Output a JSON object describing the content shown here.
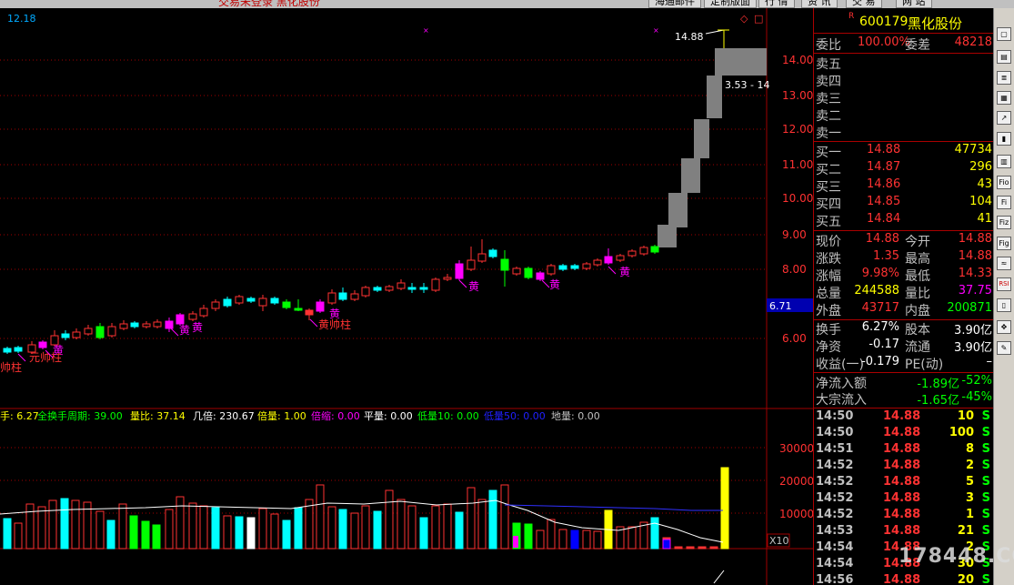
{
  "title_bar": {
    "text": "交易未登录  黑化股份"
  },
  "menu": [
    "海通邮件",
    "定制版面",
    "行 情",
    "资 讯",
    "交 易",
    "网 站"
  ],
  "price_axis": {
    "top_left_label": "12.18",
    "ticks": [
      "14.00",
      "13.00",
      "12.00",
      "11.00",
      "10.00",
      "9.00",
      "8.00",
      "6.00"
    ],
    "last_label": "6.71"
  },
  "chart_marks": {
    "high_label": "14.88",
    "range_label": "3.53 - 14",
    "huang": "黄",
    "yuanshuai": "元帅柱",
    "huangshuai": "黄帅柱",
    "hui": "帅柱"
  },
  "indicator_bar": {
    "items": [
      {
        "text": "手: 6.27",
        "color": "#ffff00"
      },
      {
        "text": "全换手周期: 39.00",
        "color": "#00ff00"
      },
      {
        "text": "量比: 37.14",
        "color": "#ffff00"
      },
      {
        "text": "几倍: 230.67",
        "color": "#ffffff"
      },
      {
        "text": "倍量: 1.00",
        "color": "#ffff00"
      },
      {
        "text": "倍缩: 0.00",
        "color": "#ff00ff"
      },
      {
        "text": "平量: 0.00",
        "color": "#ffffff"
      },
      {
        "text": "低量10: 0.00",
        "color": "#00ff00"
      },
      {
        "text": "低量50: 0.00",
        "color": "#0000ff"
      },
      {
        "text": "地量: 0.00",
        "color": "#c0c0c0"
      }
    ]
  },
  "volume_axis": {
    "ticks": [
      "30000",
      "20000",
      "10000"
    ],
    "unit": "X10"
  },
  "stock": {
    "code": "600179",
    "name": "黑化股份",
    "badge": "R"
  },
  "order_ratio": {
    "label1": "委比",
    "value1": "100.00%",
    "label2": "委差",
    "value2": "48218"
  },
  "sell": [
    {
      "label": "卖五",
      "price": "",
      "vol": ""
    },
    {
      "label": "卖四",
      "price": "",
      "vol": ""
    },
    {
      "label": "卖三",
      "price": "",
      "vol": ""
    },
    {
      "label": "卖二",
      "price": "",
      "vol": ""
    },
    {
      "label": "卖一",
      "price": "",
      "vol": ""
    }
  ],
  "buy": [
    {
      "label": "买一",
      "price": "14.88",
      "vol": "47734"
    },
    {
      "label": "买二",
      "price": "14.87",
      "vol": "296"
    },
    {
      "label": "买三",
      "price": "14.86",
      "vol": "43"
    },
    {
      "label": "买四",
      "price": "14.85",
      "vol": "104"
    },
    {
      "label": "买五",
      "price": "14.84",
      "vol": "41"
    }
  ],
  "quote": [
    {
      "l1": "现价",
      "v1": "14.88",
      "c1": "#ff3232",
      "l2": "今开",
      "v2": "14.88",
      "c2": "#ff3232"
    },
    {
      "l1": "涨跌",
      "v1": "1.35",
      "c1": "#ff3232",
      "l2": "最高",
      "v2": "14.88",
      "c2": "#ff3232"
    },
    {
      "l1": "涨幅",
      "v1": "9.98%",
      "c1": "#ff3232",
      "l2": "最低",
      "v2": "14.33",
      "c2": "#ff3232"
    },
    {
      "l1": "总量",
      "v1": "244588",
      "c1": "#ffff00",
      "l2": "量比",
      "v2": "37.75",
      "c2": "#ff00ff"
    },
    {
      "l1": "外盘",
      "v1": "43717",
      "c1": "#ff3232",
      "l2": "内盘",
      "v2": "200871",
      "c2": "#00ff00"
    }
  ],
  "fundamentals": [
    {
      "l1": "换手",
      "v1": "6.27%",
      "l2": "股本",
      "v2": "3.90亿"
    },
    {
      "l1": "净资",
      "v1": "-0.17",
      "l2": "流通",
      "v2": "3.90亿"
    },
    {
      "l1": "收益(一)",
      "v1": "-0.179",
      "l2": "PE(动)",
      "v2": "–"
    }
  ],
  "flows": [
    {
      "label": "净流入额",
      "value": "-1.89亿",
      "pct": "-52%"
    },
    {
      "label": "大宗流入",
      "value": "-1.65亿",
      "pct": "-45%"
    }
  ],
  "ticks": [
    {
      "time": "14:50",
      "price": "14.88",
      "vol": "10",
      "side": "S"
    },
    {
      "time": "14:50",
      "price": "14.88",
      "vol": "100",
      "side": "S"
    },
    {
      "time": "14:51",
      "price": "14.88",
      "vol": "8",
      "side": "S"
    },
    {
      "time": "14:52",
      "price": "14.88",
      "vol": "2",
      "side": "S"
    },
    {
      "time": "14:52",
      "price": "14.88",
      "vol": "5",
      "side": "S"
    },
    {
      "time": "14:52",
      "price": "14.88",
      "vol": "3",
      "side": "S"
    },
    {
      "time": "14:52",
      "price": "14.88",
      "vol": "1",
      "side": "S"
    },
    {
      "time": "14:53",
      "price": "14.88",
      "vol": "21",
      "side": "S"
    },
    {
      "time": "14:54",
      "price": "14.88",
      "vol": "2",
      "side": "S"
    },
    {
      "time": "14:54",
      "price": "14.88",
      "vol": "30",
      "side": "S"
    },
    {
      "time": "14:56",
      "price": "14.88",
      "vol": "20",
      "side": "S"
    }
  ],
  "watermark": "178448.COM",
  "toolbar_icons": [
    "window-icon",
    "kline-icon",
    "list-icon",
    "table-icon",
    "trend-icon",
    "candle-icon",
    "chart-icon",
    "fio-icon",
    "fi-icon",
    "fiz-icon",
    "fig-icon",
    "wave-icon",
    "rsi-icon",
    "bars-icon",
    "nav-arrows-icon",
    "pencil-icon"
  ]
}
